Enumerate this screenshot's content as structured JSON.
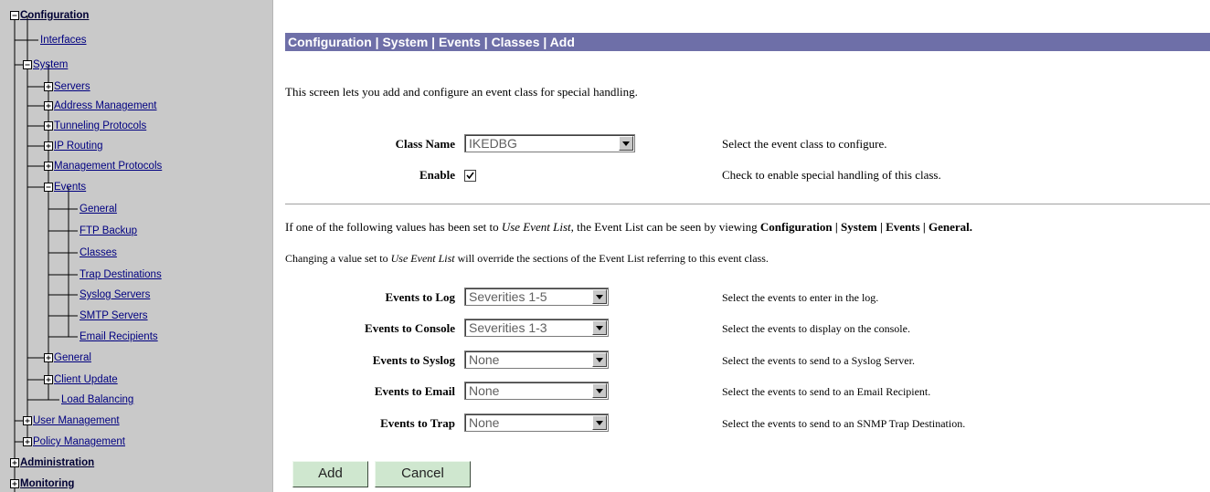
{
  "tree": [
    {
      "label": "Configuration",
      "bold": true
    },
    {
      "label": "Interfaces"
    },
    {
      "label": "System"
    },
    {
      "label": "Servers"
    },
    {
      "label": "Address Management"
    },
    {
      "label": "Tunneling Protocols"
    },
    {
      "label": "IP Routing"
    },
    {
      "label": "Management Protocols"
    },
    {
      "label": "Events"
    },
    {
      "label": "General"
    },
    {
      "label": "FTP Backup"
    },
    {
      "label": "Classes"
    },
    {
      "label": "Trap Destinations"
    },
    {
      "label": "Syslog Servers"
    },
    {
      "label": "SMTP Servers"
    },
    {
      "label": "Email Recipients"
    },
    {
      "label": "General"
    },
    {
      "label": "Client Update"
    },
    {
      "label": "Load Balancing"
    },
    {
      "label": "User Management"
    },
    {
      "label": "Policy Management"
    },
    {
      "label": "Administration",
      "bold": true
    },
    {
      "label": "Monitoring",
      "bold": true
    }
  ],
  "breadcrumb": "Configuration | System | Events | Classes | Add",
  "intro": "This screen lets you add and configure an event class for special handling.",
  "class_name": {
    "label": "Class Name",
    "value": "IKEDBG",
    "help": "Select the event class to configure."
  },
  "enable": {
    "label": "Enable",
    "checked": true,
    "help": "Check to enable special handling of this class."
  },
  "note1": {
    "pre": "If one of the following values has been set to ",
    "em": "Use Event List",
    "mid": ", the Event List can be seen by viewing ",
    "strong": "Configuration | System | Events | General."
  },
  "note2": {
    "pre": "Changing a value set to ",
    "em": "Use Event List",
    "post": " will override the sections of the Event List referring to this event class."
  },
  "events": [
    {
      "label": "Events to Log",
      "value": "Severities 1-5",
      "help": "Select the events to enter in the log."
    },
    {
      "label": "Events to Console",
      "value": "Severities 1-3",
      "help": "Select the events to display on the console."
    },
    {
      "label": "Events to Syslog",
      "value": "None",
      "help": "Select the events to send to a Syslog Server."
    },
    {
      "label": "Events to Email",
      "value": "None",
      "help": "Select the events to send to an Email Recipient."
    },
    {
      "label": "Events to Trap",
      "value": "None",
      "help": "Select the events to send to an SNMP Trap Destination."
    }
  ],
  "buttons": {
    "add": "Add",
    "cancel": "Cancel"
  },
  "colors": {
    "title_bar": "#6e6fa8",
    "tree_bg": "#c9c9c9",
    "button_bg": "#cfe7cf"
  }
}
